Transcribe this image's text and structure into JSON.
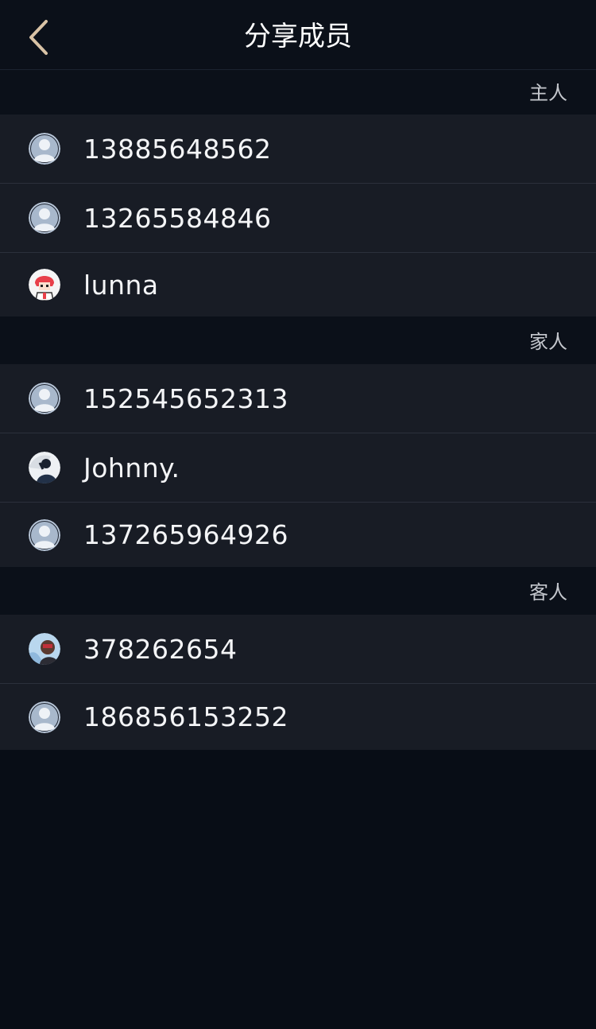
{
  "header": {
    "title": "分享成员"
  },
  "sections": [
    {
      "label": "主人",
      "members": [
        {
          "name": "13885648562",
          "avatar": "default-avatar-icon"
        },
        {
          "name": "13265584846",
          "avatar": "default-avatar-icon"
        },
        {
          "name": "lunna",
          "avatar": "photo"
        }
      ]
    },
    {
      "label": "家人",
      "members": [
        {
          "name": "152545652313",
          "avatar": "default-avatar-icon"
        },
        {
          "name": "Johnny.",
          "avatar": "photo"
        },
        {
          "name": "137265964926",
          "avatar": "default-avatar-icon"
        }
      ]
    },
    {
      "label": "客人",
      "members": [
        {
          "name": "378262654",
          "avatar": "photo"
        },
        {
          "name": "186856153252",
          "avatar": "default-avatar-icon"
        }
      ]
    }
  ],
  "colors": {
    "background": "#080d16",
    "row_background": "#181c25",
    "back_arrow": "#d9c3a6",
    "default_avatar": "#a8b8cc"
  }
}
